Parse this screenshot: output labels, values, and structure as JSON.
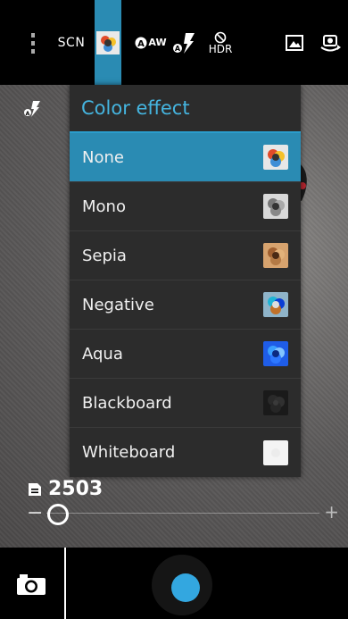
{
  "topbar": {
    "menu_icon": "vertical-dots-icon",
    "scene_label": "SCN",
    "color_effect_icon": "color-effect-icon",
    "aw_label": "AW",
    "flash_icon": "auto-flash-icon",
    "hdr_label": "HDR",
    "gallery_icon": "picture-icon",
    "switch_camera_icon": "switch-camera-icon"
  },
  "menu": {
    "title": "Color effect",
    "items": [
      {
        "label": "None",
        "selected": true,
        "thumb": "none"
      },
      {
        "label": "Mono",
        "selected": false,
        "thumb": "mono"
      },
      {
        "label": "Sepia",
        "selected": false,
        "thumb": "sepia"
      },
      {
        "label": "Negative",
        "selected": false,
        "thumb": "negative"
      },
      {
        "label": "Aqua",
        "selected": false,
        "thumb": "aqua"
      },
      {
        "label": "Blackboard",
        "selected": false,
        "thumb": "blackboard"
      },
      {
        "label": "Whiteboard",
        "selected": false,
        "thumb": "whiteboard"
      }
    ]
  },
  "status": {
    "photo_count": "2503",
    "zoom_level": 0
  },
  "colors": {
    "accent": "#2a8bb3",
    "title": "#45b5e0",
    "shutter": "#33a7e0"
  }
}
